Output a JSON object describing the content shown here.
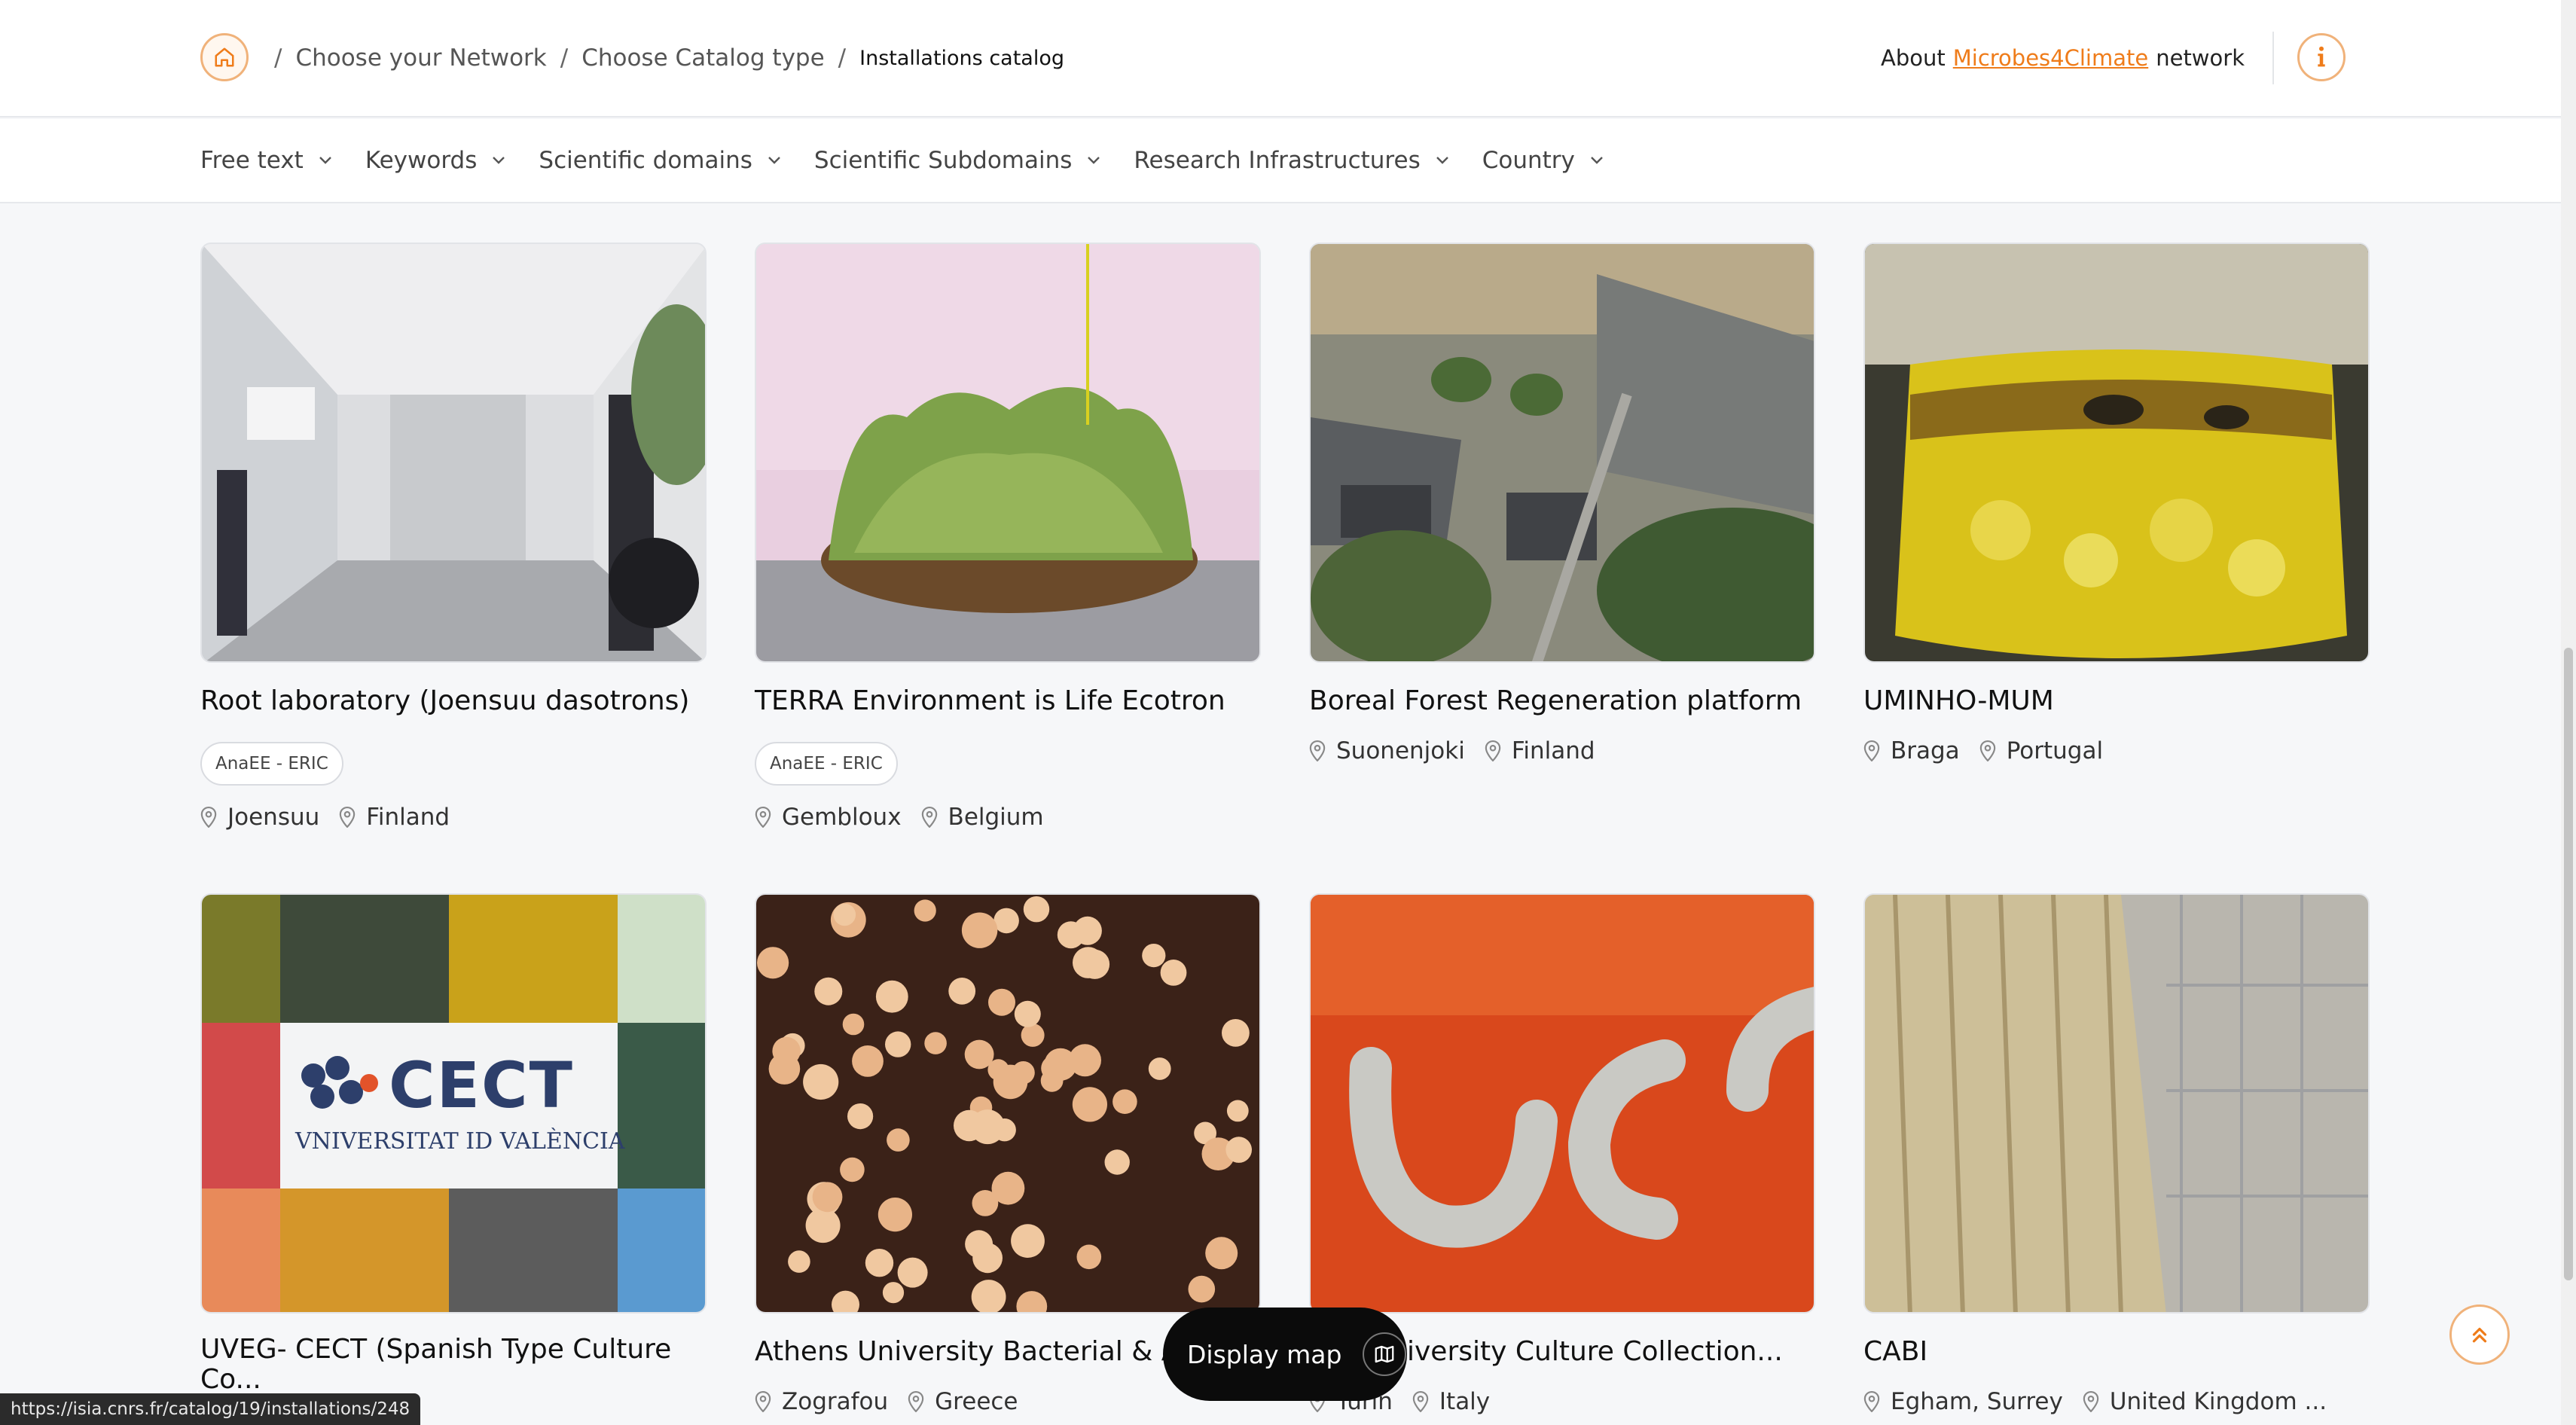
{
  "breadcrumb": {
    "home_icon": "home-icon",
    "items": [
      "Choose your Network",
      "Choose Catalog type",
      "Installations catalog"
    ],
    "separator": "/"
  },
  "about": {
    "prefix": "About",
    "network": "Microbes4Climate",
    "suffix": "network"
  },
  "filters": [
    "Free text",
    "Keywords",
    "Scientific domains",
    "Scientific Subdomains",
    "Research Infrastructures",
    "Country"
  ],
  "cards": [
    {
      "title": "Root laboratory (Joensuu dasotrons)",
      "tag": "AnaEE - ERIC",
      "city": "Joensuu",
      "country": "Finland"
    },
    {
      "title": "TERRA Environment is Life Ecotron",
      "tag": "AnaEE - ERIC",
      "city": "Gembloux",
      "country": "Belgium"
    },
    {
      "title": "Boreal Forest Regeneration platform",
      "tag": "",
      "city": "Suonenjoki",
      "country": "Finland"
    },
    {
      "title": "UMINHO-MUM",
      "tag": "",
      "city": "Braga",
      "country": "Portugal"
    },
    {
      "title": "UVEG- CECT (Spanish Type Culture Co...",
      "tag": "",
      "city": "",
      "country": "",
      "logo_text": "CECT",
      "logo_sub": "VNIVERSITAT ID VALÈNCIA"
    },
    {
      "title": "Athens University Bacterial & A",
      "tag": "",
      "city": "Zografou",
      "country": "Greece"
    },
    {
      "title": "iversity Culture Collection...",
      "tag": "",
      "city": "Turin",
      "country": "Italy"
    },
    {
      "title": "CABI",
      "tag": "",
      "city": "Egham, Surrey",
      "country": "United Kingdom ..."
    }
  ],
  "map_button": {
    "label": "Display map",
    "icon": "map-icon"
  },
  "status_url": "https://isia.cnrs.fr/catalog/19/installations/248",
  "colors": {
    "accent": "#ef7c1a",
    "accent_border": "#f0b27a",
    "dark": "#0b0b0b"
  }
}
